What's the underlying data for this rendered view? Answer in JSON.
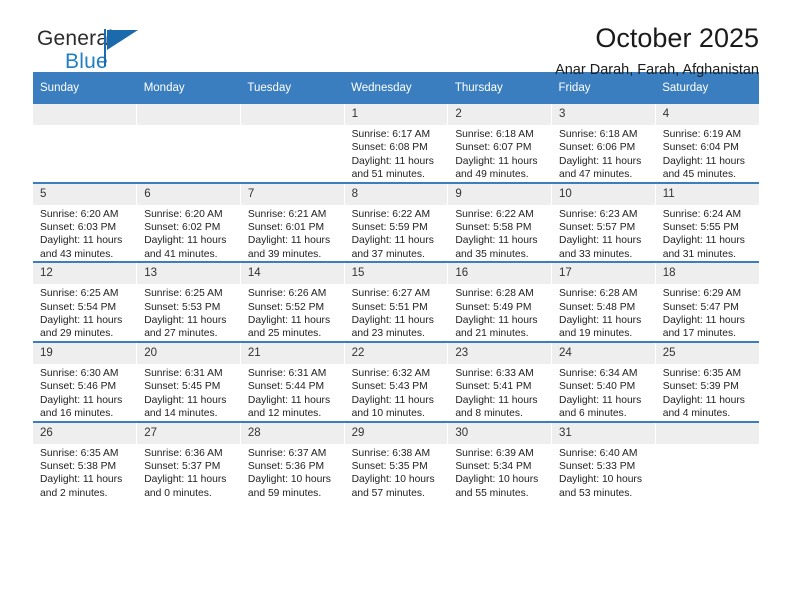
{
  "brand": {
    "name_top": "General",
    "name_bottom": "Blue",
    "accent_color": "#1f7fc4",
    "logo_triangle_color": "#1b6aab"
  },
  "header": {
    "title": "October 2025",
    "subtitle": "Anar Darah, Farah, Afghanistan"
  },
  "calendar": {
    "header_background": "#3b7ebf",
    "header_text_color": "#ffffff",
    "daynum_background": "#eeeeee",
    "weekdays": [
      "Sunday",
      "Monday",
      "Tuesday",
      "Wednesday",
      "Thursday",
      "Friday",
      "Saturday"
    ],
    "weeks": [
      [
        {
          "day": "",
          "lines": []
        },
        {
          "day": "",
          "lines": []
        },
        {
          "day": "",
          "lines": []
        },
        {
          "day": "1",
          "lines": [
            "Sunrise: 6:17 AM",
            "Sunset: 6:08 PM",
            "Daylight: 11 hours",
            "and 51 minutes."
          ]
        },
        {
          "day": "2",
          "lines": [
            "Sunrise: 6:18 AM",
            "Sunset: 6:07 PM",
            "Daylight: 11 hours",
            "and 49 minutes."
          ]
        },
        {
          "day": "3",
          "lines": [
            "Sunrise: 6:18 AM",
            "Sunset: 6:06 PM",
            "Daylight: 11 hours",
            "and 47 minutes."
          ]
        },
        {
          "day": "4",
          "lines": [
            "Sunrise: 6:19 AM",
            "Sunset: 6:04 PM",
            "Daylight: 11 hours",
            "and 45 minutes."
          ]
        }
      ],
      [
        {
          "day": "5",
          "lines": [
            "Sunrise: 6:20 AM",
            "Sunset: 6:03 PM",
            "Daylight: 11 hours",
            "and 43 minutes."
          ]
        },
        {
          "day": "6",
          "lines": [
            "Sunrise: 6:20 AM",
            "Sunset: 6:02 PM",
            "Daylight: 11 hours",
            "and 41 minutes."
          ]
        },
        {
          "day": "7",
          "lines": [
            "Sunrise: 6:21 AM",
            "Sunset: 6:01 PM",
            "Daylight: 11 hours",
            "and 39 minutes."
          ]
        },
        {
          "day": "8",
          "lines": [
            "Sunrise: 6:22 AM",
            "Sunset: 5:59 PM",
            "Daylight: 11 hours",
            "and 37 minutes."
          ]
        },
        {
          "day": "9",
          "lines": [
            "Sunrise: 6:22 AM",
            "Sunset: 5:58 PM",
            "Daylight: 11 hours",
            "and 35 minutes."
          ]
        },
        {
          "day": "10",
          "lines": [
            "Sunrise: 6:23 AM",
            "Sunset: 5:57 PM",
            "Daylight: 11 hours",
            "and 33 minutes."
          ]
        },
        {
          "day": "11",
          "lines": [
            "Sunrise: 6:24 AM",
            "Sunset: 5:55 PM",
            "Daylight: 11 hours",
            "and 31 minutes."
          ]
        }
      ],
      [
        {
          "day": "12",
          "lines": [
            "Sunrise: 6:25 AM",
            "Sunset: 5:54 PM",
            "Daylight: 11 hours",
            "and 29 minutes."
          ]
        },
        {
          "day": "13",
          "lines": [
            "Sunrise: 6:25 AM",
            "Sunset: 5:53 PM",
            "Daylight: 11 hours",
            "and 27 minutes."
          ]
        },
        {
          "day": "14",
          "lines": [
            "Sunrise: 6:26 AM",
            "Sunset: 5:52 PM",
            "Daylight: 11 hours",
            "and 25 minutes."
          ]
        },
        {
          "day": "15",
          "lines": [
            "Sunrise: 6:27 AM",
            "Sunset: 5:51 PM",
            "Daylight: 11 hours",
            "and 23 minutes."
          ]
        },
        {
          "day": "16",
          "lines": [
            "Sunrise: 6:28 AM",
            "Sunset: 5:49 PM",
            "Daylight: 11 hours",
            "and 21 minutes."
          ]
        },
        {
          "day": "17",
          "lines": [
            "Sunrise: 6:28 AM",
            "Sunset: 5:48 PM",
            "Daylight: 11 hours",
            "and 19 minutes."
          ]
        },
        {
          "day": "18",
          "lines": [
            "Sunrise: 6:29 AM",
            "Sunset: 5:47 PM",
            "Daylight: 11 hours",
            "and 17 minutes."
          ]
        }
      ],
      [
        {
          "day": "19",
          "lines": [
            "Sunrise: 6:30 AM",
            "Sunset: 5:46 PM",
            "Daylight: 11 hours",
            "and 16 minutes."
          ]
        },
        {
          "day": "20",
          "lines": [
            "Sunrise: 6:31 AM",
            "Sunset: 5:45 PM",
            "Daylight: 11 hours",
            "and 14 minutes."
          ]
        },
        {
          "day": "21",
          "lines": [
            "Sunrise: 6:31 AM",
            "Sunset: 5:44 PM",
            "Daylight: 11 hours",
            "and 12 minutes."
          ]
        },
        {
          "day": "22",
          "lines": [
            "Sunrise: 6:32 AM",
            "Sunset: 5:43 PM",
            "Daylight: 11 hours",
            "and 10 minutes."
          ]
        },
        {
          "day": "23",
          "lines": [
            "Sunrise: 6:33 AM",
            "Sunset: 5:41 PM",
            "Daylight: 11 hours",
            "and 8 minutes."
          ]
        },
        {
          "day": "24",
          "lines": [
            "Sunrise: 6:34 AM",
            "Sunset: 5:40 PM",
            "Daylight: 11 hours",
            "and 6 minutes."
          ]
        },
        {
          "day": "25",
          "lines": [
            "Sunrise: 6:35 AM",
            "Sunset: 5:39 PM",
            "Daylight: 11 hours",
            "and 4 minutes."
          ]
        }
      ],
      [
        {
          "day": "26",
          "lines": [
            "Sunrise: 6:35 AM",
            "Sunset: 5:38 PM",
            "Daylight: 11 hours",
            "and 2 minutes."
          ]
        },
        {
          "day": "27",
          "lines": [
            "Sunrise: 6:36 AM",
            "Sunset: 5:37 PM",
            "Daylight: 11 hours",
            "and 0 minutes."
          ]
        },
        {
          "day": "28",
          "lines": [
            "Sunrise: 6:37 AM",
            "Sunset: 5:36 PM",
            "Daylight: 10 hours",
            "and 59 minutes."
          ]
        },
        {
          "day": "29",
          "lines": [
            "Sunrise: 6:38 AM",
            "Sunset: 5:35 PM",
            "Daylight: 10 hours",
            "and 57 minutes."
          ]
        },
        {
          "day": "30",
          "lines": [
            "Sunrise: 6:39 AM",
            "Sunset: 5:34 PM",
            "Daylight: 10 hours",
            "and 55 minutes."
          ]
        },
        {
          "day": "31",
          "lines": [
            "Sunrise: 6:40 AM",
            "Sunset: 5:33 PM",
            "Daylight: 10 hours",
            "and 53 minutes."
          ]
        },
        {
          "day": "",
          "lines": []
        }
      ]
    ]
  }
}
